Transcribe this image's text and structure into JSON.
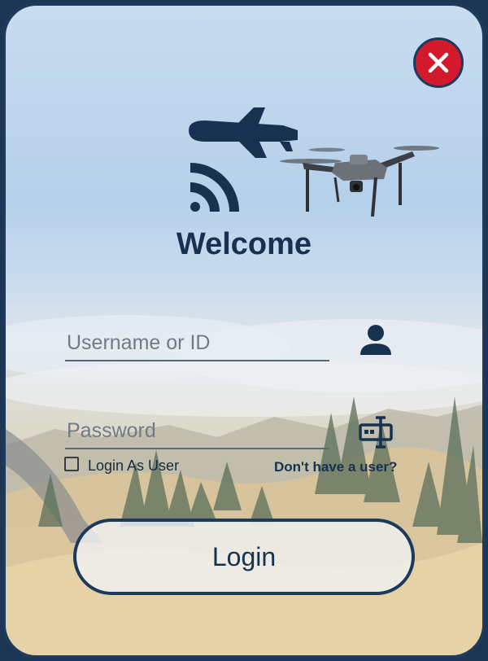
{
  "colors": {
    "accent": "#1d3a5c",
    "close_button": "#d21a2c",
    "text_dark": "#17324f"
  },
  "header": {
    "close_icon": "close-icon",
    "logo_icon": "drone-signal-logo-icon",
    "title": "Welcome"
  },
  "form": {
    "username_placeholder": "Username or ID",
    "username_value": "",
    "username_icon": "person-icon",
    "password_placeholder": "Password",
    "password_value": "",
    "password_icon": "drone-controller-icon",
    "login_as_user_label": "Login As User",
    "login_as_user_checked": false,
    "signup_link": "Don't have a user?",
    "login_button": "Login"
  }
}
